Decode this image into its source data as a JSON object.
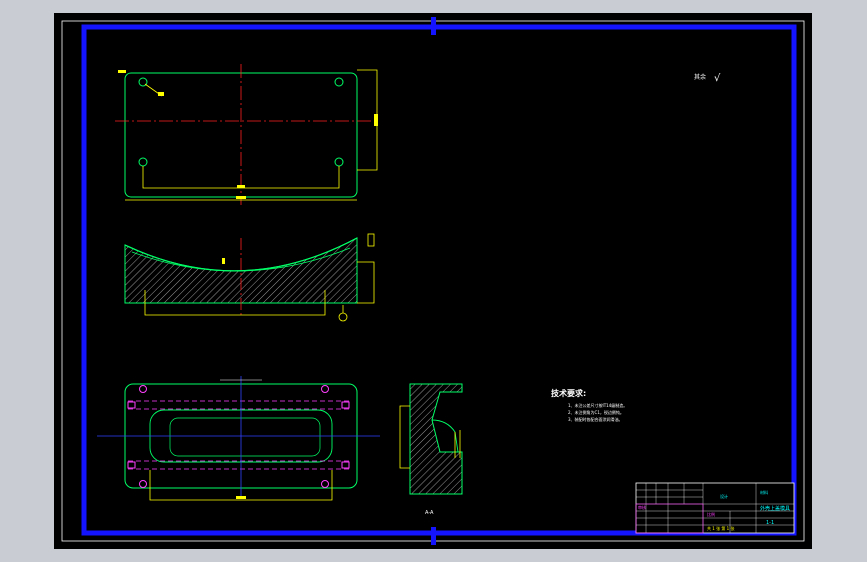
{
  "colors": {
    "window_bg": "#c9ccd2",
    "canvas_bg": "#000000",
    "frame_blue": "#1414ff",
    "outline_green": "#00ff66",
    "dim_yellow": "#ffff00",
    "centerline_red": "#ff2020",
    "hidden_magenta": "#ff40ff",
    "axis_blue": "#3040ff",
    "text_white": "#ffffff",
    "title_cyan": "#00ffff"
  },
  "drawing": {
    "roughness_label": "其余",
    "roughness_symbol": "√",
    "section_label": "A-A",
    "tech_requirements": {
      "title": "技术要求:",
      "items": [
        "1、未注公差尺寸按IT14级制造。",
        "2、未注倒角为C1，锐边倒钝。",
        "3、装配时各配合面涂润滑油。"
      ]
    }
  },
  "title_block": {
    "part_name": "外壳上盖模具",
    "drawing_no": "1-1",
    "org_label": "设计",
    "scale_label": "比例",
    "sheet_label": "共 1 张  第 1 张",
    "approve_label": "审核",
    "material_label": "材料"
  }
}
